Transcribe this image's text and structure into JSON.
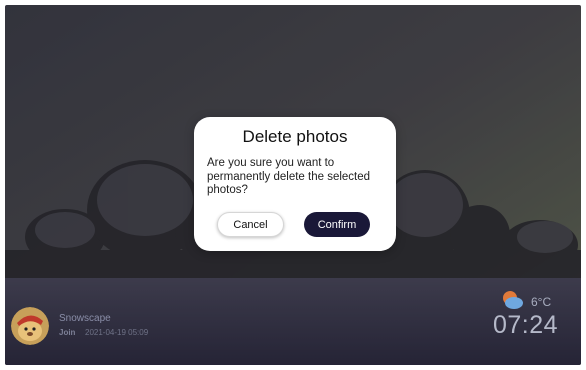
{
  "dialog": {
    "title": "Delete photos",
    "message": "Are you sure you want to permanently delete the selected photos?",
    "cancel_label": "Cancel",
    "confirm_label": "Confirm"
  },
  "wallpaper": {
    "name": "Snowscape",
    "join_label": "Join",
    "date": "2021-04-19 05:09"
  },
  "weather": {
    "temperature": "6°C",
    "icon": "partly-cloudy-icon"
  },
  "clock": {
    "time": "07:24"
  },
  "colors": {
    "confirm_bg": "#1a1838",
    "dialog_bg": "#ffffff"
  }
}
